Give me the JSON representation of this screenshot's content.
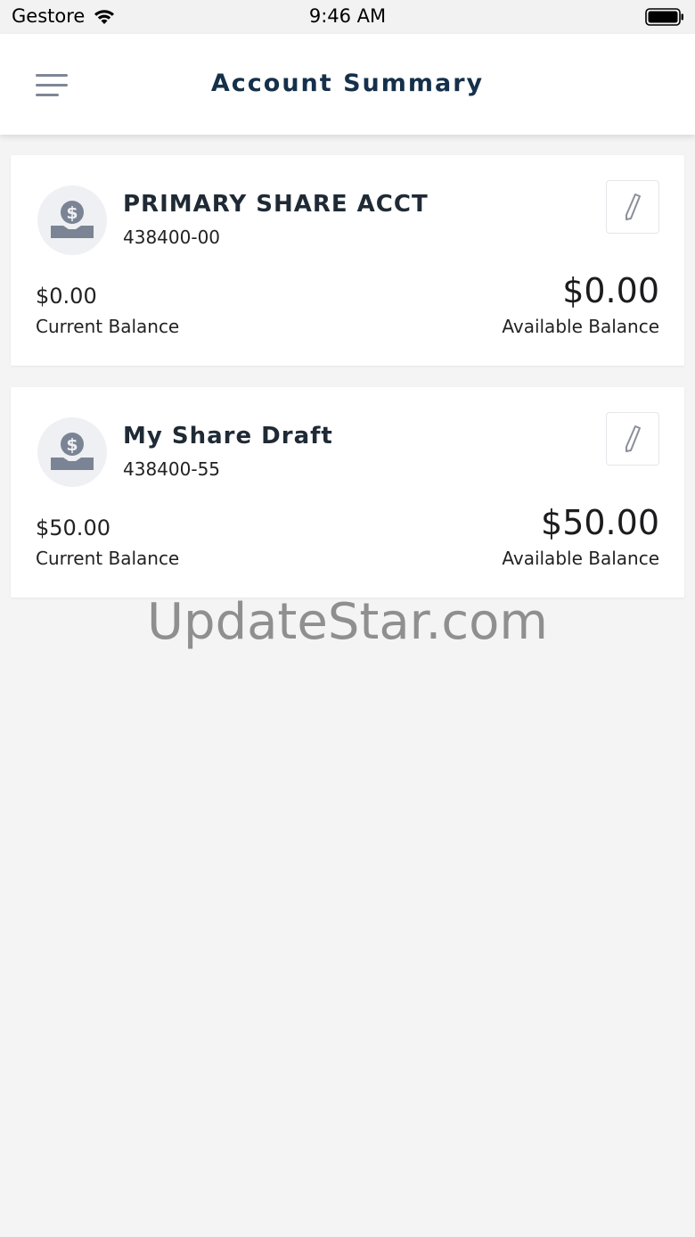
{
  "status_bar": {
    "carrier": "Gestore",
    "time": "9:46 AM"
  },
  "header": {
    "title": "Account Summary"
  },
  "accounts": [
    {
      "name": "PRIMARY SHARE ACCT",
      "number": "438400-00",
      "current_balance": "$0.00",
      "current_balance_label": "Current Balance",
      "available_balance": "$0.00",
      "available_balance_label": "Available Balance"
    },
    {
      "name": "My Share Draft",
      "number": "438400-55",
      "current_balance": "$50.00",
      "current_balance_label": "Current Balance",
      "available_balance": "$50.00",
      "available_balance_label": "Available Balance"
    }
  ],
  "watermark": "UpdateStar.com",
  "icons": {
    "menu": "hamburger-menu-icon",
    "account": "money-hand-icon",
    "edit": "pencil-icon"
  },
  "colors": {
    "title": "#15304a",
    "background": "#f4f4f4",
    "icon_gray": "#7e8796"
  }
}
